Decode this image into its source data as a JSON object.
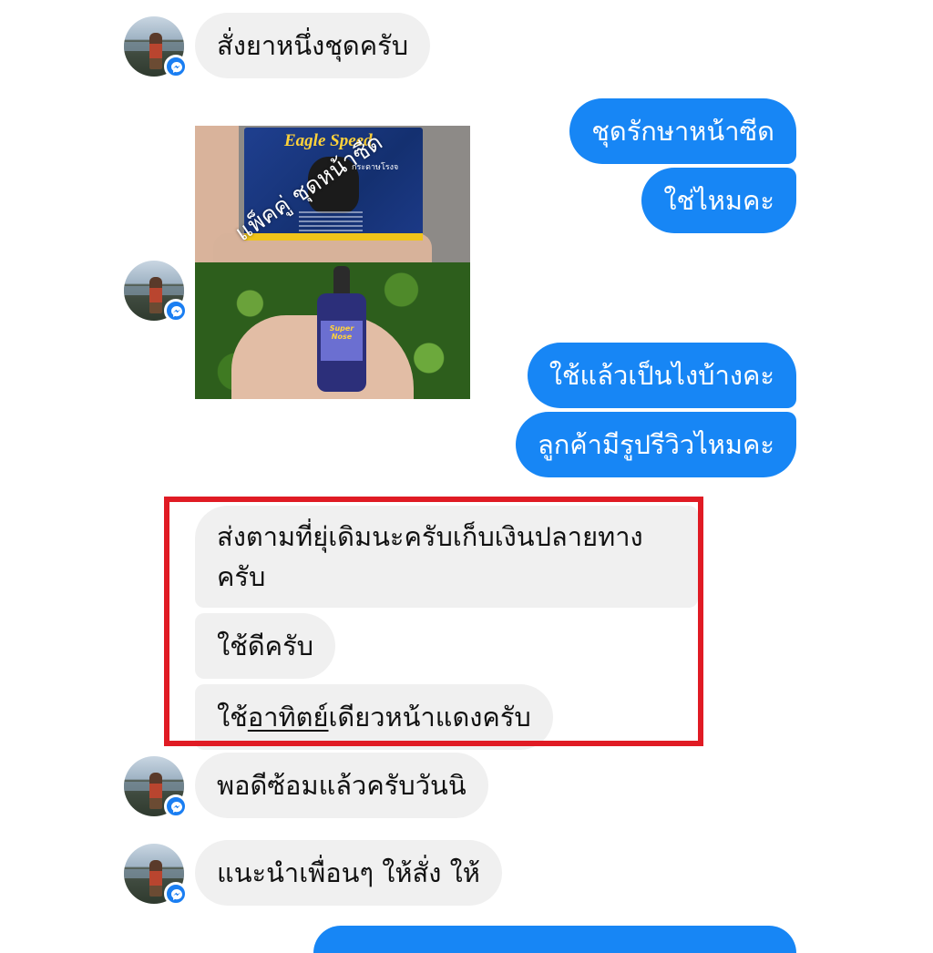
{
  "messages": {
    "m1": "สั่งยาหนึ่งชุดครับ",
    "m2": "ชุดรักษาหน้าซีด",
    "m3": "ใช่ไหมคะ",
    "m4": "ใช้แล้วเป็นไงบ้างคะ",
    "m5": "ลูกค้ามีรูปรีวิวไหมคะ",
    "m6_line1": "ส่งตามที่ยุ่เดิมนะครับเก็บเงินปลายทาง",
    "m6_line2": "ครับ",
    "m7": "ใช้ดีครับ",
    "m8_pre": "ใช้",
    "m8_underlined": "อาทิตย์",
    "m8_post": "เดียวหน้าแดงครับ",
    "m9": "พอดีซ้อมแล้วครับวันนิ",
    "m10": "แนะนำเพื่อนๆ ให้สั่ง ให้"
  },
  "product_image": {
    "box_brand": "Eagle Speed",
    "box_subtitle": "กระดาษโรงจ",
    "watermark": "แพ็คคู่ ชุดหน้าซีด",
    "bottle_label": "Super Nose"
  },
  "colors": {
    "outgoing_bubble": "#1786f5",
    "incoming_bubble": "#f0f0f0",
    "highlight_border": "#e01b24",
    "messenger_badge": "#1a7ef2"
  }
}
